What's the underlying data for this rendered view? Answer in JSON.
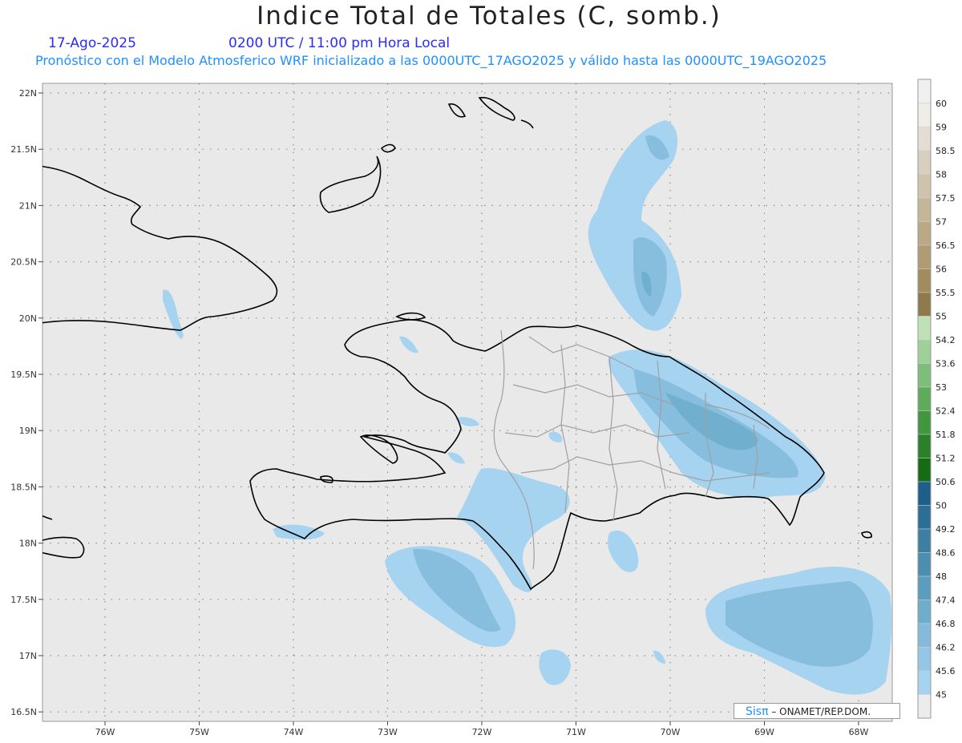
{
  "header": {
    "title": "Indice Total de Totales (C, somb.)",
    "date": "17-Ago-2025",
    "time": "0200 UTC / 11:00 pm Hora Local",
    "subtitle": "Pronóstico con el Modelo Atmosferico WRF inicializado a las 0000UTC_17AGO2025 y válido hasta las  0000UTC_19AGO2025"
  },
  "map": {
    "lat_labels": [
      "22N",
      "21.5N",
      "21N",
      "20.5N",
      "20N",
      "19.5N",
      "19N",
      "18.5N",
      "18N",
      "17.5N",
      "17N",
      "16.5N"
    ],
    "lon_labels": [
      "76W",
      "75W",
      "74W",
      "73W",
      "72W",
      "71W",
      "70W",
      "69W",
      "68W"
    ],
    "background_color": "#e9e9e9",
    "coast_color": "#000000",
    "province_color": "#a0a0a0"
  },
  "legend": {
    "levels": [
      "60",
      "59",
      "58.5",
      "58",
      "57.5",
      "57",
      "56.5",
      "56",
      "55.5",
      "55",
      "54.2",
      "53.6",
      "53",
      "52.4",
      "51.8",
      "51.2",
      "50.6",
      "50",
      "49.2",
      "48.6",
      "48",
      "47.4",
      "46.8",
      "46.2",
      "45.6",
      "45"
    ],
    "colors": [
      "#f0ede6",
      "#e3ddd3",
      "#d8cfbf",
      "#cfc3ad",
      "#c5b69a",
      "#bba986",
      "#b09b72",
      "#a18c5e",
      "#8f7a4c",
      "#c0e0b8",
      "#9ed09a",
      "#7dbf7a",
      "#5eab5c",
      "#40973f",
      "#2a8129",
      "#146c14",
      "#1c5f8a",
      "#2b6f96",
      "#3b7fa3",
      "#4a8fb0",
      "#5b9dbf",
      "#6fadcd",
      "#84bbdb",
      "#95c6e5",
      "#a6d3f0",
      "#ececec"
    ]
  },
  "credit": {
    "brand": "Sisπ",
    "text": " –  ONAMET/REP.DOM."
  }
}
